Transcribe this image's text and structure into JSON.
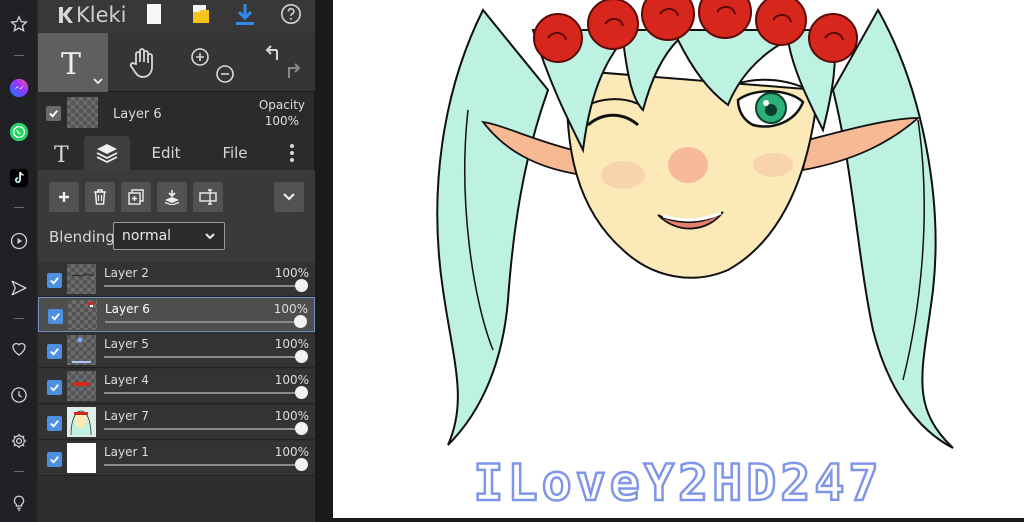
{
  "app": {
    "logo_text": "Kleki"
  },
  "layer_info": {
    "name": "Layer 6",
    "opacity_label": "Opacity",
    "opacity_value": "100%"
  },
  "tabs": {
    "edit": "Edit",
    "file": "File"
  },
  "blending": {
    "label": "Blending",
    "value": "normal"
  },
  "layers": [
    {
      "name": "Layer 2",
      "opacity": "100%",
      "selected": false
    },
    {
      "name": "Layer 6",
      "opacity": "100%",
      "selected": true
    },
    {
      "name": "Layer 5",
      "opacity": "100%",
      "selected": false
    },
    {
      "name": "Layer 4",
      "opacity": "100%",
      "selected": false
    },
    {
      "name": "Layer 7",
      "opacity": "100%",
      "selected": false
    },
    {
      "name": "Layer 1",
      "opacity": "100%",
      "selected": false
    }
  ],
  "artwork": {
    "text": "ILoveY2HD247"
  },
  "colors": {
    "accent": "#4d8fe0",
    "hair": "#bdf2e2",
    "roses": "#d7261c",
    "skin": "#fbe9b8"
  },
  "icons": {
    "sidebar": [
      "star-icon",
      "messenger-icon",
      "whatsapp-icon",
      "tiktok-icon",
      "play-icon",
      "send-icon",
      "heart-icon",
      "clock-icon",
      "gear-icon",
      "lightbulb-icon"
    ]
  }
}
